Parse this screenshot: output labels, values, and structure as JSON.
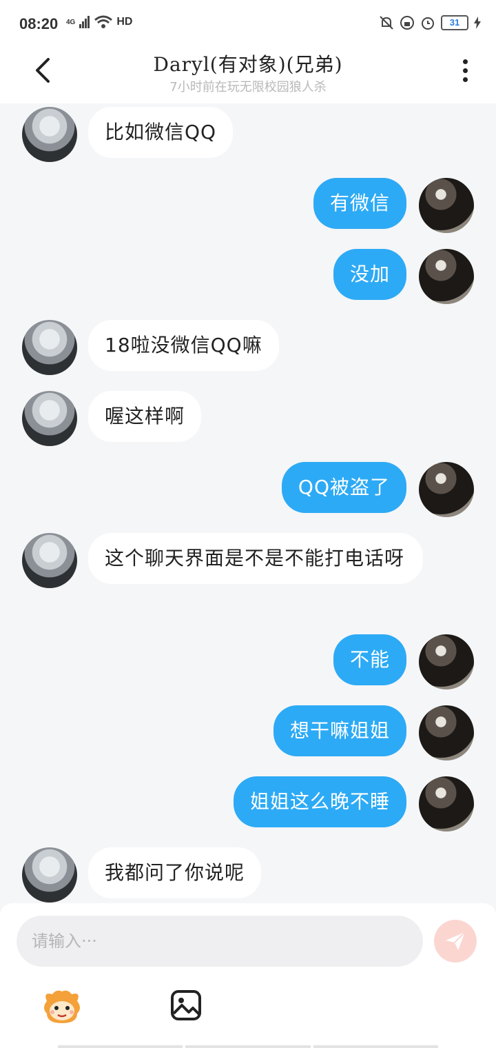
{
  "status_bar": {
    "time": "08:20",
    "network": "4G",
    "hd": "HD",
    "battery": "31"
  },
  "header": {
    "title": "Daryl(有对象)(兄弟)",
    "subtitle": "7小时前在玩无限校园狼人杀"
  },
  "messages": [
    {
      "side": "left",
      "text": "比如微信QQ"
    },
    {
      "side": "right",
      "text": "有微信"
    },
    {
      "side": "right",
      "text": "没加"
    },
    {
      "side": "left",
      "text": "18啦没微信QQ嘛"
    },
    {
      "side": "left",
      "text": "喔这样啊"
    },
    {
      "side": "right",
      "text": "QQ被盗了"
    },
    {
      "side": "left",
      "text": "这个聊天界面是不是不能打电话呀"
    },
    {
      "side": "right",
      "text": "不能"
    },
    {
      "side": "right",
      "text": "想干嘛姐姐"
    },
    {
      "side": "right",
      "text": "姐姐这么晚不睡"
    },
    {
      "side": "left",
      "text": "我都问了你说呢"
    }
  ],
  "input": {
    "placeholder": "请输入···"
  },
  "colors": {
    "accent_bubble": "#2daaf5",
    "send_button": "#fbd6d0"
  },
  "icons": [
    "back-icon",
    "more-icon",
    "send-icon",
    "mascot-icon",
    "image-icon"
  ]
}
